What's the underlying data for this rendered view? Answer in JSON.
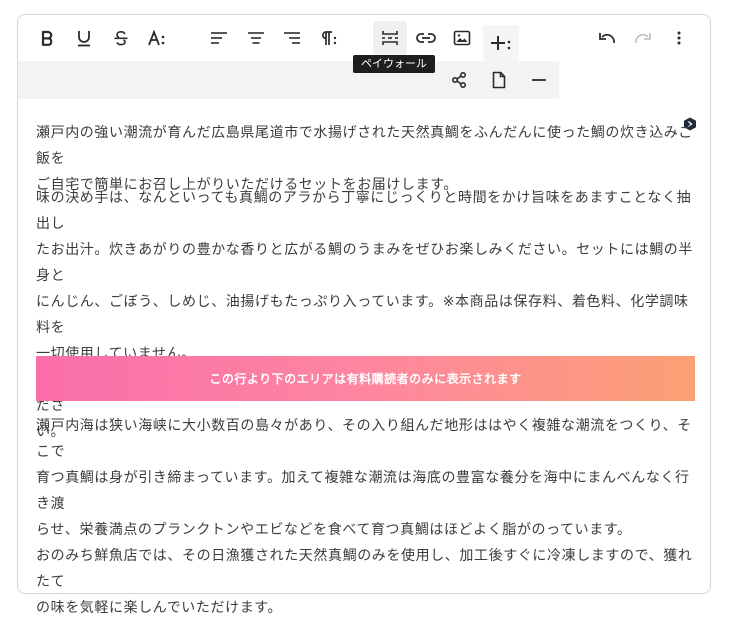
{
  "toolbar": {
    "row1": [
      {
        "name": "bold-button",
        "icon": "bold-icon"
      },
      {
        "name": "underline-button",
        "icon": "underline-icon"
      },
      {
        "name": "strikethrough-button",
        "icon": "strikethrough-icon"
      },
      {
        "name": "font-size-button",
        "icon": "font-size-icon"
      },
      {
        "name": "align-left-button",
        "icon": "align-left-icon"
      },
      {
        "name": "align-center-button",
        "icon": "align-center-icon"
      },
      {
        "name": "align-right-button",
        "icon": "align-right-icon"
      },
      {
        "name": "paragraph-button",
        "icon": "paragraph-icon"
      },
      {
        "name": "paywall-button",
        "icon": "paywall-icon"
      },
      {
        "name": "link-button",
        "icon": "link-icon"
      },
      {
        "name": "image-button",
        "icon": "image-icon"
      },
      {
        "name": "insert-button",
        "icon": "plus-icon"
      },
      {
        "name": "undo-button",
        "icon": "undo-icon"
      },
      {
        "name": "redo-button",
        "icon": "redo-icon"
      },
      {
        "name": "more-button",
        "icon": "more-vertical-icon"
      }
    ],
    "row2": [
      {
        "name": "share-button",
        "icon": "share-icon"
      },
      {
        "name": "document-button",
        "icon": "document-icon"
      },
      {
        "name": "divider-button",
        "icon": "minus-icon"
      }
    ],
    "tooltip": "ペイウォール"
  },
  "content": {
    "paragraph1": "瀬戸内の強い潮流が育んだ広島県尾道市で水揚げされた天然真鯛をふんだんに使った鯛の炊き込みご飯を\nご自宅で簡単にお召し上がりいただけるセットをお届けします。",
    "paragraph2": "味の決め手は、なんといっても真鯛のアラから丁寧にじっくりと時間をかけ旨味をあますことなく抽出し\nたお出汁。炊きあがりの豊かな香りと広がる鯛のうまみをぜひお楽しみください。セットには鯛の半身と\nにんじん、ごぼう、しめじ、油揚げもたっぷり入っています。※本商品は保存料、着色料、化学調味料を\n一切使用していません。\nちょっとした記念日に。節句のお祝いに。ご自宅で気軽に手軽に美味しい瀬戸内の味覚をお楽しみくださ\nい。",
    "paywall_label": "この行より下のエリアは有料購読者のみに表示されます",
    "paragraph3": "瀬戸内海は狭い海峡に大小数百の島々があり、その入り組んだ地形ははやく複雑な潮流をつくり、そこで\n育つ真鯛は身が引き締まっています。加えて複雑な潮流は海底の豊富な養分を海中にまんべんなく行き渡\nらせ、栄養満点のプランクトンやエビなどを食べて育つ真鯛はほどよく脂がのっています。\nおのみち鮮魚店では、その日漁獲された天然真鯛のみを使用し、加工後すぐに冷凍しますので、獲れたて\nの味を気軽に楽しんでいただけます。"
  },
  "colors": {
    "banner_start": "#fa6eab",
    "banner_end": "#fca074",
    "text": "#3b3b3b",
    "icon": "#2b2b2b",
    "icon_disabled": "#c4c4c4"
  }
}
